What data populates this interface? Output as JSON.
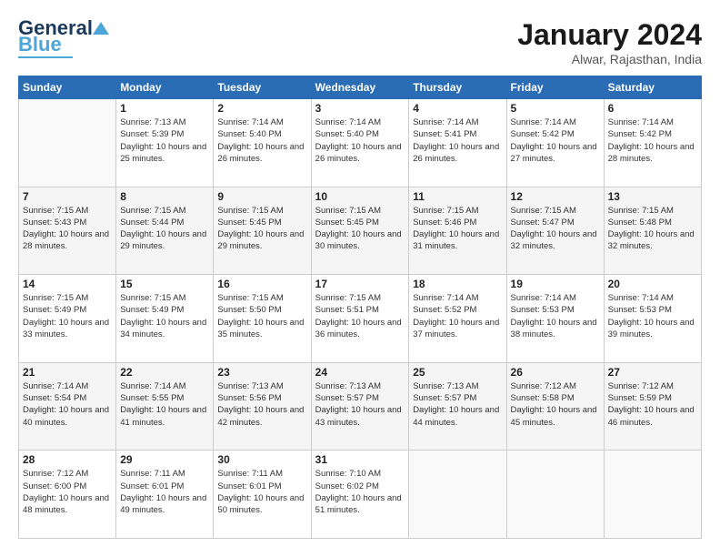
{
  "logo": {
    "line1": "General",
    "line2": "Blue"
  },
  "header": {
    "month": "January 2024",
    "location": "Alwar, Rajasthan, India"
  },
  "days_of_week": [
    "Sunday",
    "Monday",
    "Tuesday",
    "Wednesday",
    "Thursday",
    "Friday",
    "Saturday"
  ],
  "weeks": [
    [
      {
        "num": "",
        "sunrise": "",
        "sunset": "",
        "daylight": "",
        "empty": true
      },
      {
        "num": "1",
        "sunrise": "7:13 AM",
        "sunset": "5:39 PM",
        "daylight": "10 hours and 25 minutes."
      },
      {
        "num": "2",
        "sunrise": "7:14 AM",
        "sunset": "5:40 PM",
        "daylight": "10 hours and 26 minutes."
      },
      {
        "num": "3",
        "sunrise": "7:14 AM",
        "sunset": "5:40 PM",
        "daylight": "10 hours and 26 minutes."
      },
      {
        "num": "4",
        "sunrise": "7:14 AM",
        "sunset": "5:41 PM",
        "daylight": "10 hours and 26 minutes."
      },
      {
        "num": "5",
        "sunrise": "7:14 AM",
        "sunset": "5:42 PM",
        "daylight": "10 hours and 27 minutes."
      },
      {
        "num": "6",
        "sunrise": "7:14 AM",
        "sunset": "5:42 PM",
        "daylight": "10 hours and 28 minutes."
      }
    ],
    [
      {
        "num": "7",
        "sunrise": "7:15 AM",
        "sunset": "5:43 PM",
        "daylight": "10 hours and 28 minutes."
      },
      {
        "num": "8",
        "sunrise": "7:15 AM",
        "sunset": "5:44 PM",
        "daylight": "10 hours and 29 minutes."
      },
      {
        "num": "9",
        "sunrise": "7:15 AM",
        "sunset": "5:45 PM",
        "daylight": "10 hours and 29 minutes."
      },
      {
        "num": "10",
        "sunrise": "7:15 AM",
        "sunset": "5:45 PM",
        "daylight": "10 hours and 30 minutes."
      },
      {
        "num": "11",
        "sunrise": "7:15 AM",
        "sunset": "5:46 PM",
        "daylight": "10 hours and 31 minutes."
      },
      {
        "num": "12",
        "sunrise": "7:15 AM",
        "sunset": "5:47 PM",
        "daylight": "10 hours and 32 minutes."
      },
      {
        "num": "13",
        "sunrise": "7:15 AM",
        "sunset": "5:48 PM",
        "daylight": "10 hours and 32 minutes."
      }
    ],
    [
      {
        "num": "14",
        "sunrise": "7:15 AM",
        "sunset": "5:49 PM",
        "daylight": "10 hours and 33 minutes."
      },
      {
        "num": "15",
        "sunrise": "7:15 AM",
        "sunset": "5:49 PM",
        "daylight": "10 hours and 34 minutes."
      },
      {
        "num": "16",
        "sunrise": "7:15 AM",
        "sunset": "5:50 PM",
        "daylight": "10 hours and 35 minutes."
      },
      {
        "num": "17",
        "sunrise": "7:15 AM",
        "sunset": "5:51 PM",
        "daylight": "10 hours and 36 minutes."
      },
      {
        "num": "18",
        "sunrise": "7:14 AM",
        "sunset": "5:52 PM",
        "daylight": "10 hours and 37 minutes."
      },
      {
        "num": "19",
        "sunrise": "7:14 AM",
        "sunset": "5:53 PM",
        "daylight": "10 hours and 38 minutes."
      },
      {
        "num": "20",
        "sunrise": "7:14 AM",
        "sunset": "5:53 PM",
        "daylight": "10 hours and 39 minutes."
      }
    ],
    [
      {
        "num": "21",
        "sunrise": "7:14 AM",
        "sunset": "5:54 PM",
        "daylight": "10 hours and 40 minutes."
      },
      {
        "num": "22",
        "sunrise": "7:14 AM",
        "sunset": "5:55 PM",
        "daylight": "10 hours and 41 minutes."
      },
      {
        "num": "23",
        "sunrise": "7:13 AM",
        "sunset": "5:56 PM",
        "daylight": "10 hours and 42 minutes."
      },
      {
        "num": "24",
        "sunrise": "7:13 AM",
        "sunset": "5:57 PM",
        "daylight": "10 hours and 43 minutes."
      },
      {
        "num": "25",
        "sunrise": "7:13 AM",
        "sunset": "5:57 PM",
        "daylight": "10 hours and 44 minutes."
      },
      {
        "num": "26",
        "sunrise": "7:12 AM",
        "sunset": "5:58 PM",
        "daylight": "10 hours and 45 minutes."
      },
      {
        "num": "27",
        "sunrise": "7:12 AM",
        "sunset": "5:59 PM",
        "daylight": "10 hours and 46 minutes."
      }
    ],
    [
      {
        "num": "28",
        "sunrise": "7:12 AM",
        "sunset": "6:00 PM",
        "daylight": "10 hours and 48 minutes."
      },
      {
        "num": "29",
        "sunrise": "7:11 AM",
        "sunset": "6:01 PM",
        "daylight": "10 hours and 49 minutes."
      },
      {
        "num": "30",
        "sunrise": "7:11 AM",
        "sunset": "6:01 PM",
        "daylight": "10 hours and 50 minutes."
      },
      {
        "num": "31",
        "sunrise": "7:10 AM",
        "sunset": "6:02 PM",
        "daylight": "10 hours and 51 minutes."
      },
      {
        "num": "",
        "sunrise": "",
        "sunset": "",
        "daylight": "",
        "empty": true
      },
      {
        "num": "",
        "sunrise": "",
        "sunset": "",
        "daylight": "",
        "empty": true
      },
      {
        "num": "",
        "sunrise": "",
        "sunset": "",
        "daylight": "",
        "empty": true
      }
    ]
  ]
}
